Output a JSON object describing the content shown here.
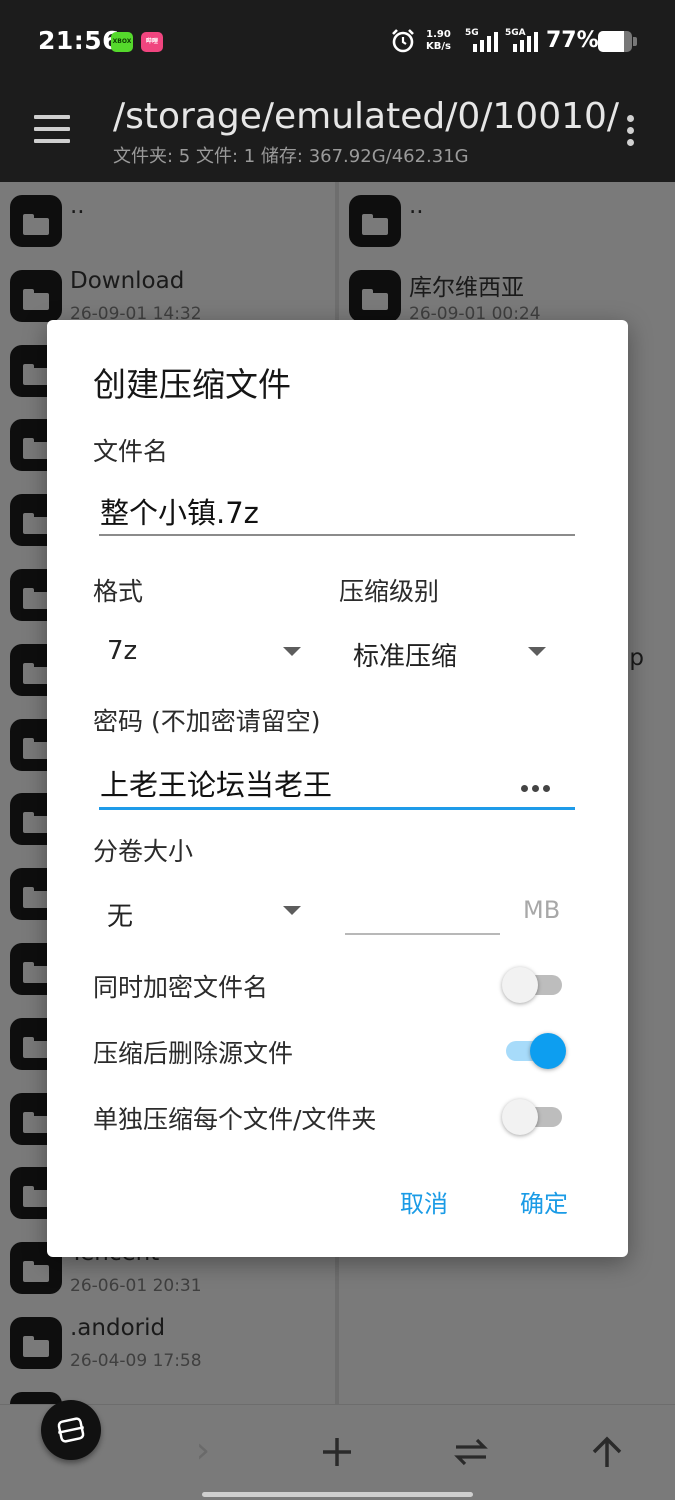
{
  "status_bar": {
    "time": "21:56",
    "app_badge_1": "XBOX",
    "app_badge_2": "哔哩",
    "net_speed_value": "1.90",
    "net_speed_unit": "KB/s",
    "sim1_label": "5G",
    "sim2_label": "5GA",
    "battery_text": "77%",
    "battery_level": 0.77
  },
  "toolbar": {
    "path": "/storage/emulated/0/10010/",
    "subtitle": "文件夹: 5  文件: 1  储存: 367.92G/462.31G"
  },
  "left_pane": {
    "items": [
      {
        "name": "..",
        "date": ""
      },
      {
        "name": "Download",
        "date": "26-09-01 14:32"
      },
      {
        "name": "",
        "date": ""
      },
      {
        "name": "",
        "date": ""
      },
      {
        "name": "",
        "date": ""
      },
      {
        "name": "",
        "date": ""
      },
      {
        "name": "",
        "date": ""
      },
      {
        "name": "",
        "date": ""
      },
      {
        "name": "",
        "date": ""
      },
      {
        "name": "",
        "date": ""
      },
      {
        "name": "",
        "date": ""
      },
      {
        "name": "",
        "date": ""
      },
      {
        "name": "",
        "date": ""
      },
      {
        "name": "",
        "date": ""
      },
      {
        "name": "Tencent",
        "date": "26-06-01 20:31"
      },
      {
        "name": ".andorid",
        "date": "26-04-09 17:58"
      },
      {
        "name": "",
        "date": ""
      }
    ]
  },
  "right_pane": {
    "items": [
      {
        "name": "..",
        "date": ""
      },
      {
        "name": "库尔维西亚",
        "date": "26-09-01 00:24"
      }
    ],
    "partial_text": "ip"
  },
  "dialog": {
    "title": "创建压缩文件",
    "filename_label": "文件名",
    "filename_value": "整个小镇.7z",
    "format_label": "格式",
    "format_value": "7z",
    "level_label": "压缩级别",
    "level_value": "标准压缩",
    "password_label": "密码 (不加密请留空)",
    "password_value": "上老王论坛当老王",
    "volume_label": "分卷大小",
    "volume_value": "无",
    "volume_unit": "MB",
    "option_encrypt_names": {
      "label": "同时加密文件名",
      "on": false
    },
    "option_delete_source": {
      "label": "压缩后删除源文件",
      "on": true
    },
    "option_separate": {
      "label": "单独压缩每个文件/文件夹",
      "on": false
    },
    "cancel_label": "取消",
    "ok_label": "确定"
  },
  "colors": {
    "accent": "#1e9be9",
    "dark_bar": "#1c1c1c",
    "scrim_gray": "#7a7a7a"
  }
}
